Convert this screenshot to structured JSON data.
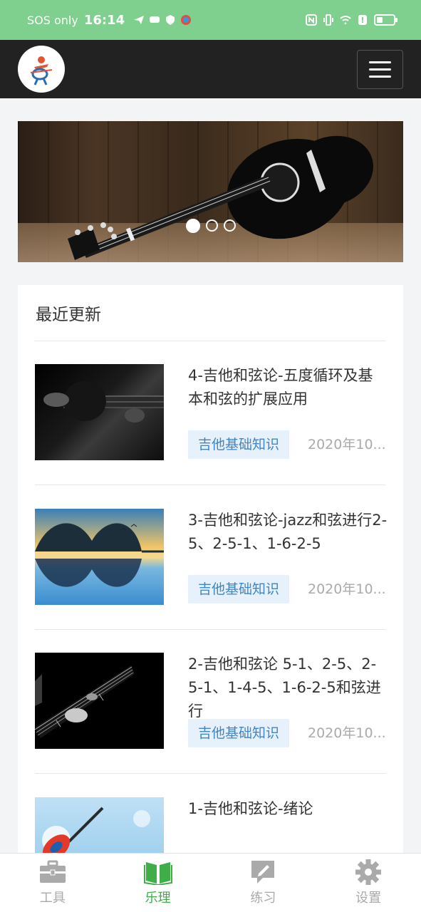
{
  "status_bar": {
    "carrier": "SOS only",
    "time": "16:14",
    "battery_level": 0.35
  },
  "header": {
    "logo_icon": "guitar-player-logo",
    "menu_icon": "hamburger-menu-icon"
  },
  "banner": {
    "slides_total": 3,
    "active_slide": 1
  },
  "recent": {
    "title": "最近更新",
    "articles": [
      {
        "title": "4-吉他和弦论-五度循环及基本和弦的扩展应用",
        "tag": "吉他基础知识",
        "date": "2020年10..."
      },
      {
        "title": "3-吉他和弦论-jazz和弦进行2-5、2-5-1、1-6-2-5",
        "tag": "吉他基础知识",
        "date": "2020年10..."
      },
      {
        "title": "2-吉他和弦论 5-1、2-5、2-5-1、1-4-5、1-6-2-5和弦进行",
        "tag": "吉他基础知识",
        "date": "2020年10..."
      },
      {
        "title": "1-吉他和弦论-绪论",
        "tag": "",
        "date": ""
      }
    ]
  },
  "tabbar": {
    "tabs": [
      {
        "label": "工具",
        "icon": "toolbox-icon"
      },
      {
        "label": "乐理",
        "icon": "book-icon"
      },
      {
        "label": "练习",
        "icon": "edit-icon"
      },
      {
        "label": "设置",
        "icon": "gear-icon"
      }
    ],
    "active_color": "#3fae48",
    "inactive_color": "#aaaaaa"
  }
}
